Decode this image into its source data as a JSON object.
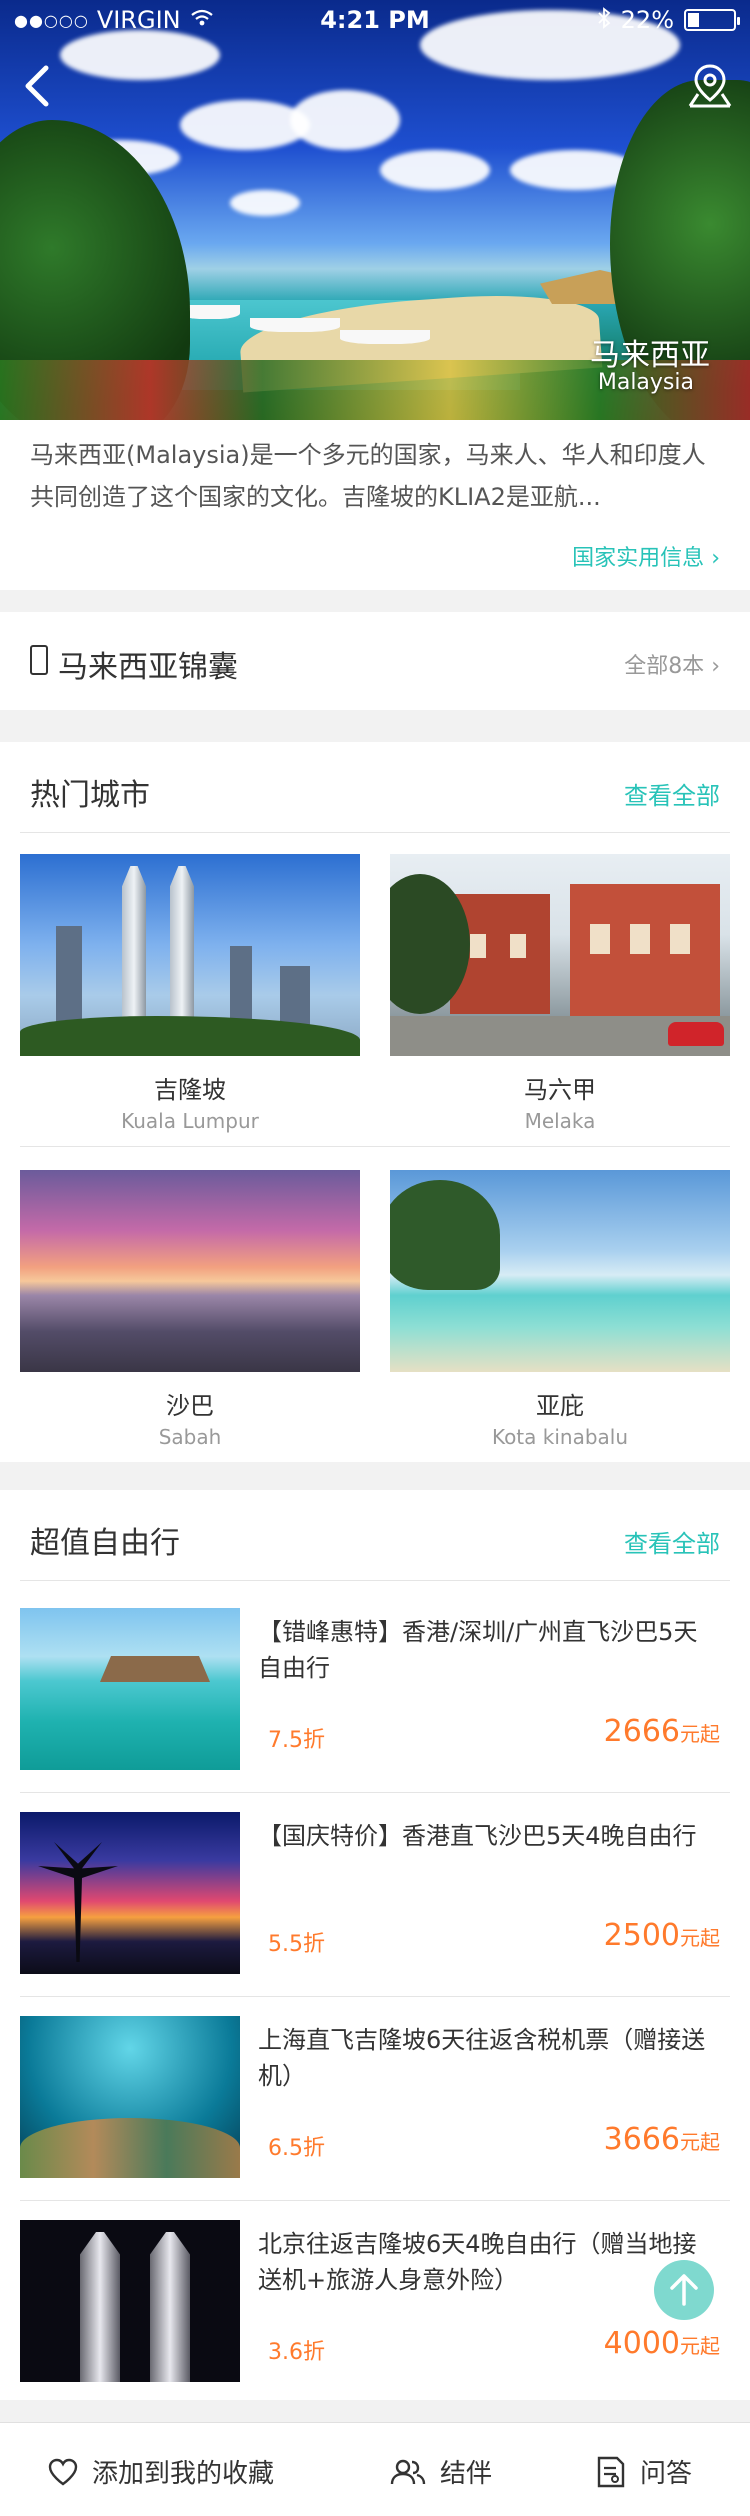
{
  "status_bar": {
    "carrier": "VIRGIN",
    "time": "4:21 PM",
    "battery": "22%",
    "battery_level": 0.22
  },
  "hero": {
    "title": "马来西亚",
    "subtitle": "Malaysia"
  },
  "intro": {
    "text": "马来西亚(Malaysia)是一个多元的国家，马来人、华人和印度人共同创造了这个国家的文化。吉隆坡的KLIA2是亚航...",
    "link": "国家实用信息"
  },
  "guide": {
    "title": "马来西亚锦囊",
    "more": "全部8本"
  },
  "hot_cities": {
    "title": "热门城市",
    "more": "查看全部",
    "cities": [
      {
        "cn": "吉隆坡",
        "en": "Kuala Lumpur"
      },
      {
        "cn": "马六甲",
        "en": "Melaka"
      },
      {
        "cn": "沙巴",
        "en": "Sabah"
      },
      {
        "cn": "亚庇",
        "en": "Kota kinabalu"
      }
    ]
  },
  "deals": {
    "title": "超值自由行",
    "more": "查看全部",
    "items": [
      {
        "title": "【错峰惠特】香港/深圳/广州直飞沙巴5天自由行",
        "discount": "7.5折",
        "price": "2666",
        "unit": "元起"
      },
      {
        "title": "【国庆特价】香港直飞沙巴5天4晚自由行",
        "discount": "5.5折",
        "price": "2500",
        "unit": "元起"
      },
      {
        "title": "上海直飞吉隆坡6天往返含税机票（赠接送机）",
        "discount": "6.5折",
        "price": "3666",
        "unit": "元起"
      },
      {
        "title": "北京往返吉隆坡6天4晚自由行（赠当地接送机+旅游人身意外险）",
        "discount": "3.6折",
        "price": "4000",
        "unit": "元起"
      }
    ]
  },
  "bottom_bar": {
    "favorite": "添加到我的收藏",
    "companion": "结伴",
    "qa": "问答"
  },
  "colors": {
    "accent": "#28c3b8",
    "price": "#ff7a2c",
    "fab": "#7fd9cf"
  }
}
